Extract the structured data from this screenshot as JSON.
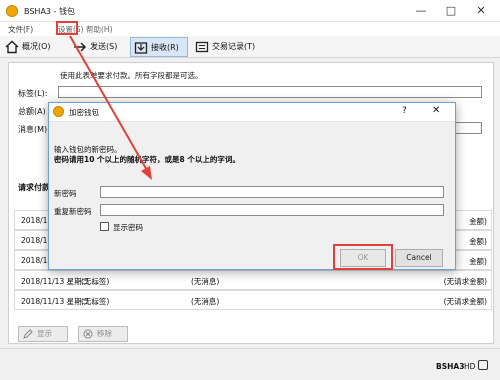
{
  "window": {
    "title": "BSHA3 - 钱包",
    "minimize": "—",
    "maximize": "□",
    "close": "✕"
  },
  "menu": {
    "file": "文件(F)",
    "settings": "设置(S)",
    "help": "帮助(H)"
  },
  "toolbar": {
    "overview": "概况(O)",
    "send": "发送(S)",
    "receive": "接收(R)",
    "transactions": "交易记录(T)"
  },
  "receive": {
    "info": "使用此表单要求付款。所有字段都是可选。",
    "label_field": "标签(L):",
    "amount_field": "总额(A)",
    "message_field": "消息(M)",
    "history_title": "请求付款"
  },
  "history": {
    "rows": [
      {
        "date": "2018/11",
        "label": "",
        "message": "",
        "amount": "金额)"
      },
      {
        "date": "2018/11",
        "label": "",
        "message": "",
        "amount": "金额)"
      },
      {
        "date": "2018/11",
        "label": "",
        "message": "",
        "amount": "金额)"
      },
      {
        "date": "2018/11/13 星期二 ...",
        "label": "(无标签)",
        "message": "(无消息)",
        "amount": "(无请求金额)"
      },
      {
        "date": "2018/11/13 星期二 ...",
        "label": "(无标签)",
        "message": "(无消息)",
        "amount": "(无请求金额)"
      }
    ]
  },
  "actions": {
    "show": "显示",
    "remove": "移除"
  },
  "status": {
    "network": "BSHA3",
    "hd": "HD"
  },
  "dialog": {
    "title": "加密钱包",
    "help": "?",
    "close": "✕",
    "instruction_line1": "输入钱包的新密码。",
    "instruction_line2": "密码请用10 个以上的随机字符，或是8 个以上的字词。",
    "new_password_label": "新密码",
    "repeat_password_label": "重复新密码",
    "show_password_label": "显示密码",
    "ok_label": "OK",
    "cancel_label": "Cancel"
  },
  "colors": {
    "highlight": "#e0413a",
    "active_tab": "#d8e6f5",
    "dialog_border": "#6e9fd6"
  }
}
